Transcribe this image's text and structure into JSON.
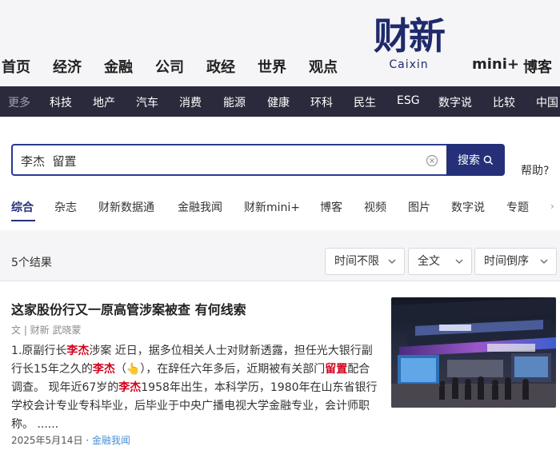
{
  "header": {
    "nav": [
      "首页",
      "经济",
      "金融",
      "公司",
      "政经",
      "世界",
      "观点"
    ],
    "logo_cn": "财新",
    "logo_en": "Caixin",
    "nav_right": [
      "mini+",
      "博客"
    ]
  },
  "subnav": {
    "more_label": "更多",
    "items": [
      "科技",
      "地产",
      "汽车",
      "消费",
      "能源",
      "健康",
      "环科",
      "民生",
      "ESG",
      "数字说",
      "比较",
      "中国"
    ]
  },
  "search": {
    "query": "李杰  留置",
    "button_label": "搜索",
    "help_label": "帮助?"
  },
  "tabs": [
    "综合",
    "杂志",
    "财新数据通",
    "金融我闻",
    "财新mini+",
    "博客",
    "视频",
    "图片",
    "数字说",
    "专题"
  ],
  "results": {
    "count_label": "5个结果",
    "filters": [
      "时间不限",
      "全文",
      "时间倒序"
    ]
  },
  "result": {
    "title": "这家股份行又一原高管涉案被查 有何线索",
    "meta": "文 | 财新 武晓蒙",
    "snippet": {
      "s1": "1.原副行长",
      "h1": "李杰",
      "s2": "涉案 近日，据多位相关人士对财新透露，担任光大银行副行长15年之久的",
      "h2": "李杰",
      "s3": "（👆），在辞任六年多后，近期被有关部门",
      "h3": "留置",
      "s4": "配合调查。 现年近67岁的",
      "h4": "李杰",
      "s5": "1958年出生，本科学历，1980年在山东省银行学校会计专业专科毕业，后毕业于中央广播电视大学金融专业，会计师职称。 ......"
    },
    "date": "2025年5月14日 · ",
    "source": "金融我闻"
  },
  "colors": {
    "brand": "#253079",
    "subnav_bg": "#2b2a3c",
    "highlight": "#d0021b",
    "source_link": "#4a8fd3"
  }
}
